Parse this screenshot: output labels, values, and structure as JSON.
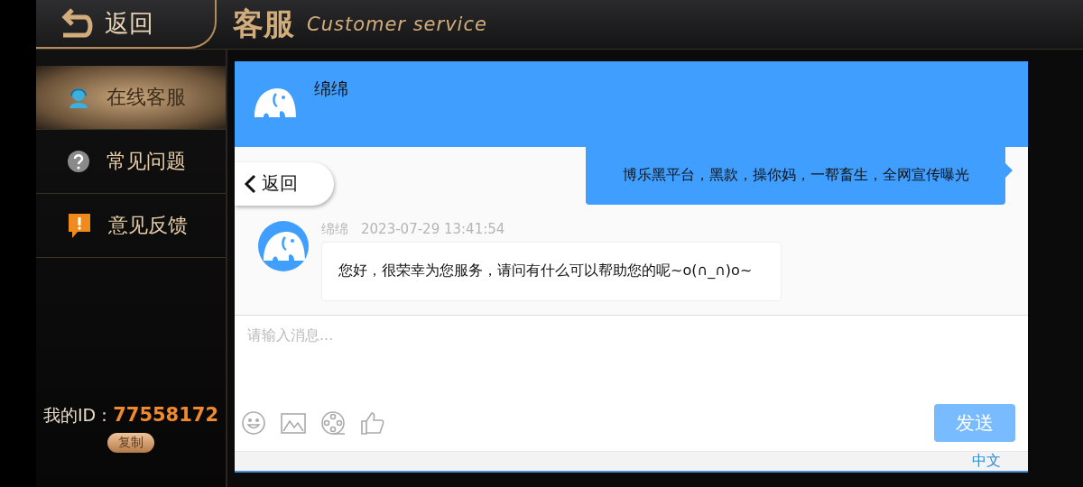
{
  "header": {
    "back": "返回",
    "title": "客服",
    "subtitle": "Customer service"
  },
  "sidebar": {
    "items": [
      {
        "label": "在线客服",
        "kind": "agent",
        "selected": true
      },
      {
        "label": "常见问题",
        "kind": "question",
        "selected": false
      },
      {
        "label": "意见反馈",
        "kind": "feedback",
        "selected": false
      }
    ],
    "id_label": "我的ID：",
    "id_value": "77558172",
    "copy": "复制"
  },
  "chat": {
    "agent_name": "绵绵",
    "back": "返回",
    "messages": [
      {
        "kind": "outgoing",
        "text": "博乐黑平台，黑款，操你妈，一帮畜生，全网宣传曝光"
      },
      {
        "kind": "incoming",
        "sender": "绵绵",
        "time": "2023-07-29 13:41:54",
        "text": "您好，很荣幸为您服务，请问有什么可以帮助您的呢~o(∩_∩)o~"
      }
    ],
    "input": {
      "placeholder": "请输入消息..."
    },
    "send": "发送",
    "language": "中文"
  }
}
